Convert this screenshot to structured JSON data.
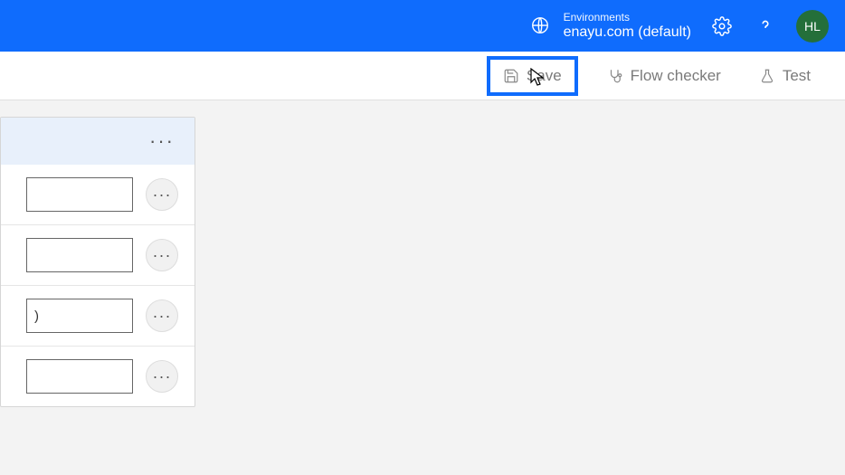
{
  "header": {
    "env_label": "Environments",
    "env_name": "enayu.com (default)",
    "avatar_initials": "HL"
  },
  "toolbar": {
    "save_label": "Save",
    "flow_checker_label": "Flow checker",
    "test_label": "Test"
  },
  "card": {
    "rows": [
      {
        "value": ""
      },
      {
        "value": ""
      },
      {
        "value": ")"
      },
      {
        "value": ""
      }
    ]
  }
}
